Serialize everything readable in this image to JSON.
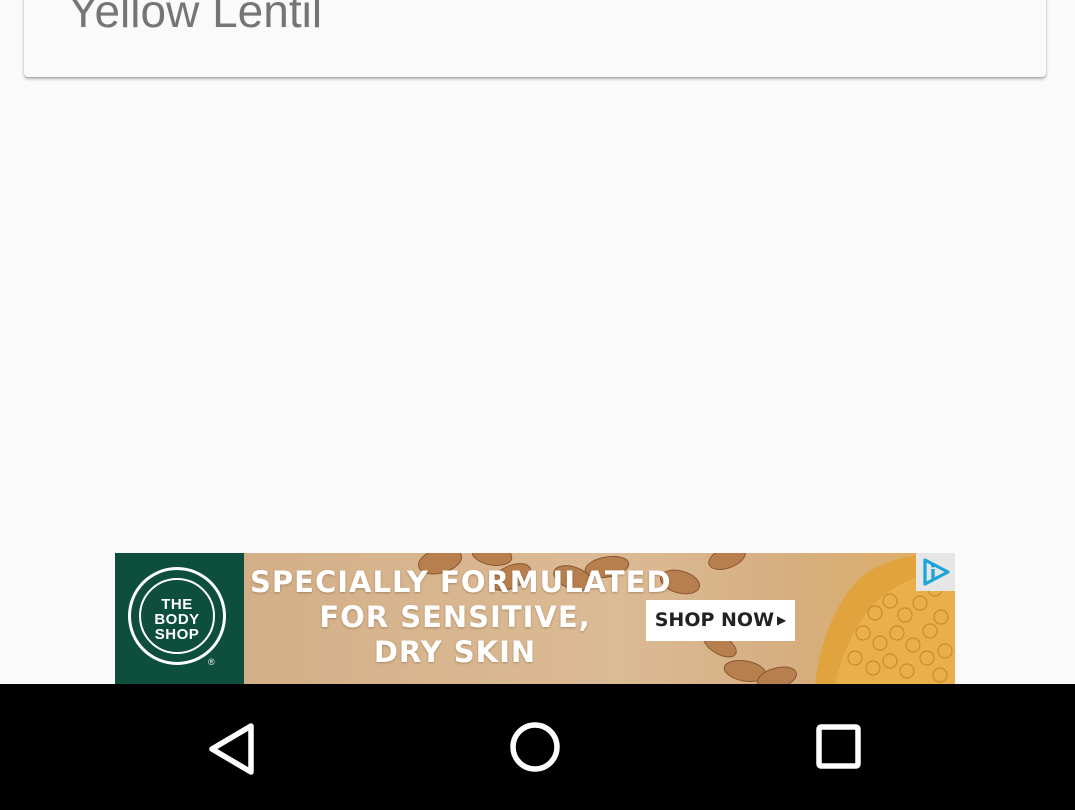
{
  "card": {
    "title": "Yellow Lentil"
  },
  "ad": {
    "brand_lines": [
      "THE",
      "BODY",
      "SHOP"
    ],
    "brand_reg": "®",
    "headline_lines": [
      "SPECIALLY FORMULATED",
      "FOR SENSITIVE,",
      "DRY SKIN"
    ],
    "cta_label": "SHOP NOW",
    "cta_icon": "play-triangle-icon",
    "choices_icon": "adchoices-icon",
    "colors": {
      "brand_green": "#0e4e3c",
      "adchoices_blue": "#1aa5d8"
    }
  },
  "navbar": {
    "back_icon": "back-triangle-icon",
    "home_icon": "home-circle-icon",
    "recents_icon": "recents-square-icon",
    "background": "#000000"
  }
}
